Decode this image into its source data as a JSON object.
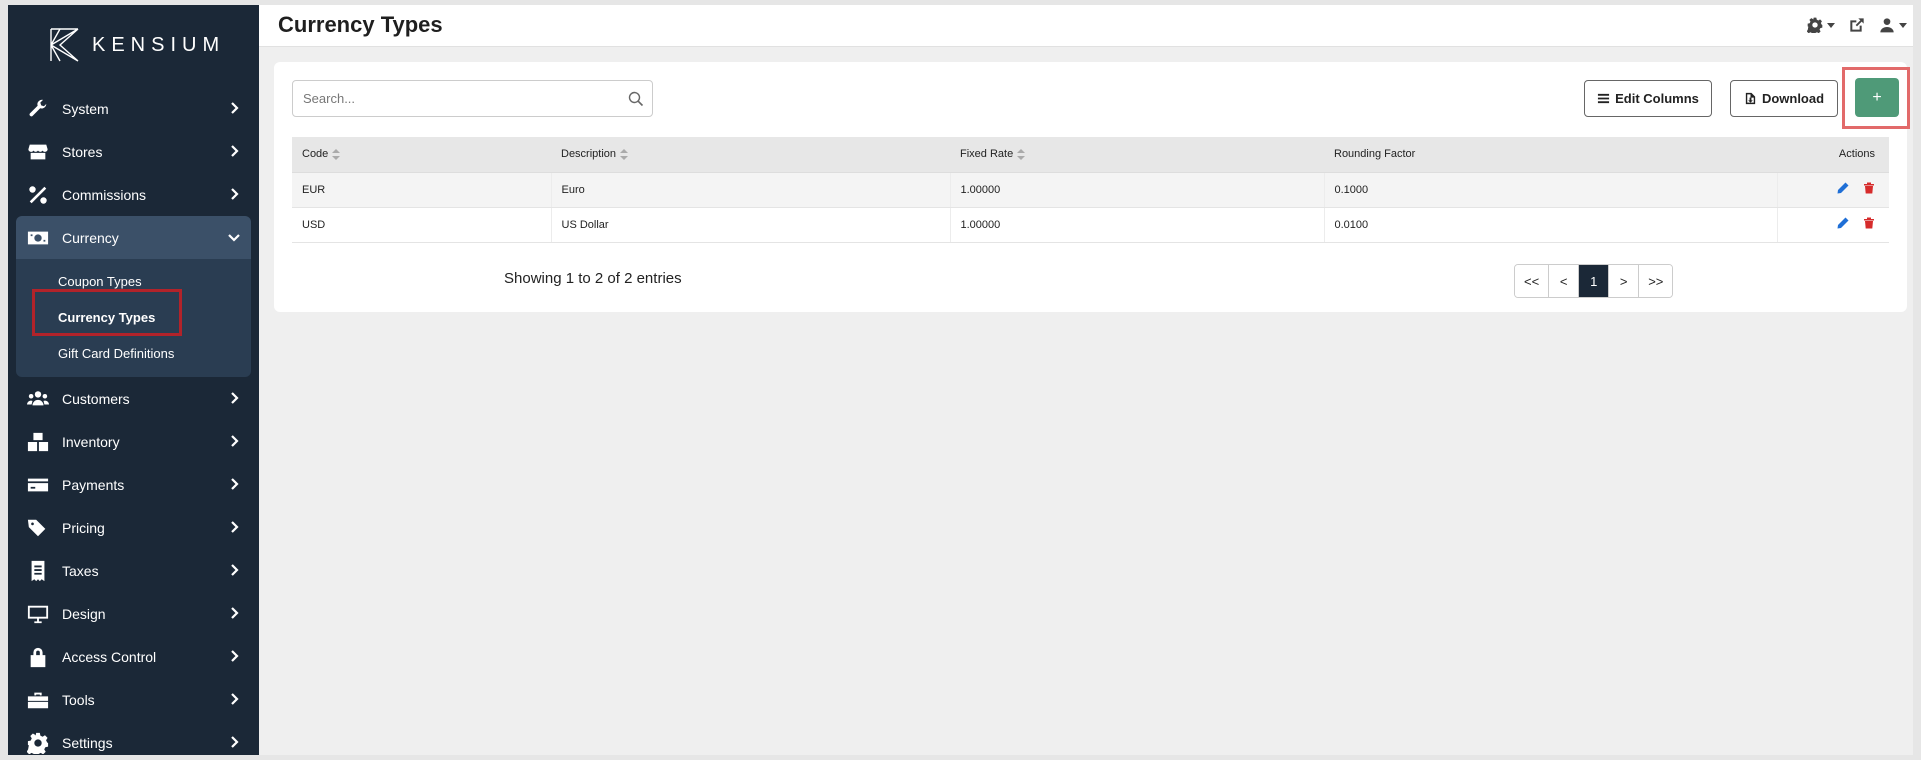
{
  "brand": {
    "name": "KENSIUM"
  },
  "header": {
    "title": "Currency Types"
  },
  "sidebar": {
    "items": [
      {
        "label": "System",
        "icon": "wrench-icon"
      },
      {
        "label": "Stores",
        "icon": "store-icon"
      },
      {
        "label": "Commissions",
        "icon": "percent-icon"
      },
      {
        "label": "Currency",
        "icon": "money-bill-icon"
      },
      {
        "label": "Customers",
        "icon": "users-icon"
      },
      {
        "label": "Inventory",
        "icon": "boxes-icon"
      },
      {
        "label": "Payments",
        "icon": "credit-card-icon"
      },
      {
        "label": "Pricing",
        "icon": "tags-icon"
      },
      {
        "label": "Taxes",
        "icon": "receipt-icon"
      },
      {
        "label": "Design",
        "icon": "desktop-icon"
      },
      {
        "label": "Access Control",
        "icon": "lock-icon"
      },
      {
        "label": "Tools",
        "icon": "toolbox-icon"
      },
      {
        "label": "Settings",
        "icon": "gear-icon"
      }
    ],
    "currency_sub": [
      {
        "label": "Coupon Types"
      },
      {
        "label": "Currency Types"
      },
      {
        "label": "Gift Card Definitions"
      }
    ]
  },
  "toolbar": {
    "search_placeholder": "Search...",
    "edit_columns_label": "Edit Columns",
    "download_label": "Download",
    "add_label": "+"
  },
  "table": {
    "columns": [
      "Code",
      "Description",
      "Fixed Rate",
      "Rounding Factor",
      "Actions"
    ],
    "rows": [
      {
        "code": "EUR",
        "description": "Euro",
        "fixed_rate": "1.00000",
        "rounding_factor": "0.1000"
      },
      {
        "code": "USD",
        "description": "US Dollar",
        "fixed_rate": "1.00000",
        "rounding_factor": "0.0100"
      }
    ]
  },
  "footer": {
    "showing": "Showing 1 to 2 of 2 entries",
    "pager": [
      "<<",
      "<",
      "1",
      ">",
      ">>"
    ]
  },
  "colors": {
    "sidebar_bg": "#1b2837",
    "active_bg": "#3b5068",
    "add_button": "#4f9a78",
    "edit_icon": "#1f6fd6",
    "delete_icon": "#d62b2b"
  }
}
